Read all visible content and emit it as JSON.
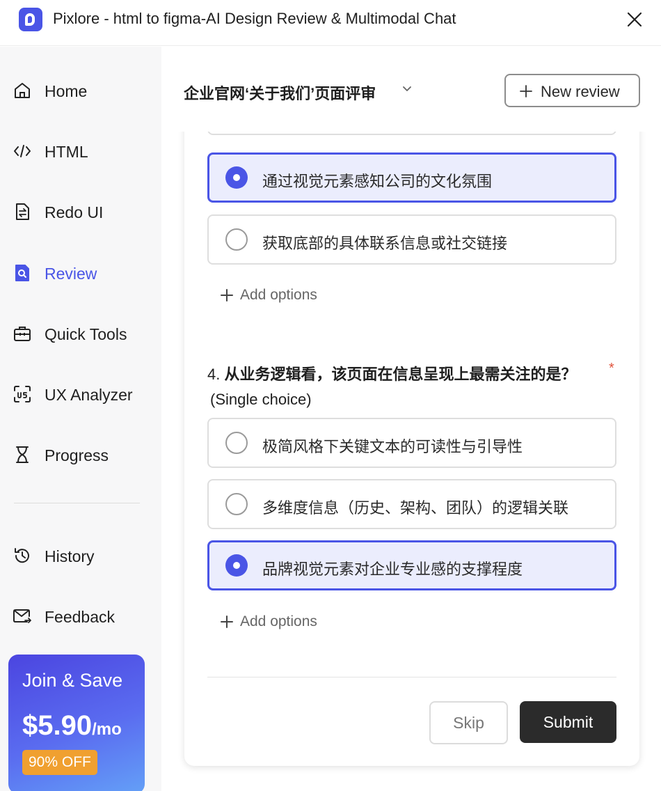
{
  "window": {
    "title": "Pixlore - html to figma-AI Design Review & Multimodal Chat",
    "logo_icon": "pixlore-logo-icon",
    "close_icon": "close-icon"
  },
  "sidebar": {
    "items": [
      {
        "label": "Home",
        "icon": "home-icon",
        "active": false
      },
      {
        "label": "HTML",
        "icon": "code-icon",
        "active": false
      },
      {
        "label": "Redo UI",
        "icon": "redo-document-icon",
        "active": false
      },
      {
        "label": "Review",
        "icon": "review-icon",
        "active": true
      },
      {
        "label": "Quick Tools",
        "icon": "toolbox-icon",
        "active": false
      },
      {
        "label": "UX Analyzer",
        "icon": "ux-analyzer-icon",
        "active": false
      },
      {
        "label": "Progress",
        "icon": "hourglass-icon",
        "active": false
      }
    ],
    "bottom_items": [
      {
        "label": "History",
        "icon": "history-icon"
      },
      {
        "label": "Feedback",
        "icon": "mail-icon"
      }
    ],
    "promo": {
      "title": "Join & Save",
      "price": "$5.90",
      "period": "/mo",
      "badge": "90% OFF"
    }
  },
  "main": {
    "review_title": "企业官网‘关于我们’页面评审",
    "new_review_label": "New review",
    "question3": {
      "options": [
        {
          "label": "通过视觉元素感知公司的文化氛围",
          "selected": true
        },
        {
          "label": "获取底部的具体联系信息或社交链接",
          "selected": false
        }
      ],
      "add_options_label": "Add options"
    },
    "question4": {
      "number": "4.",
      "text": "从业务逻辑看，该页面在信息呈现上最需关注的是？",
      "type": "(Single choice)",
      "required_mark": "*",
      "options": [
        {
          "label": "极简风格下关键文本的可读性与引导性",
          "selected": false
        },
        {
          "label": "多维度信息（历史、架构、团队）的逻辑关联",
          "selected": false
        },
        {
          "label": "品牌视觉元素对企业专业感的支撑程度",
          "selected": true
        }
      ],
      "add_options_label": "Add options"
    },
    "skip_label": "Skip",
    "submit_label": "Submit"
  },
  "colors": {
    "accent": "#4a55e6",
    "selected_bg": "#ebedfd",
    "submit_bg": "#2b2b2b",
    "required": "#e0533c",
    "promo_badge": "#f0a030"
  }
}
